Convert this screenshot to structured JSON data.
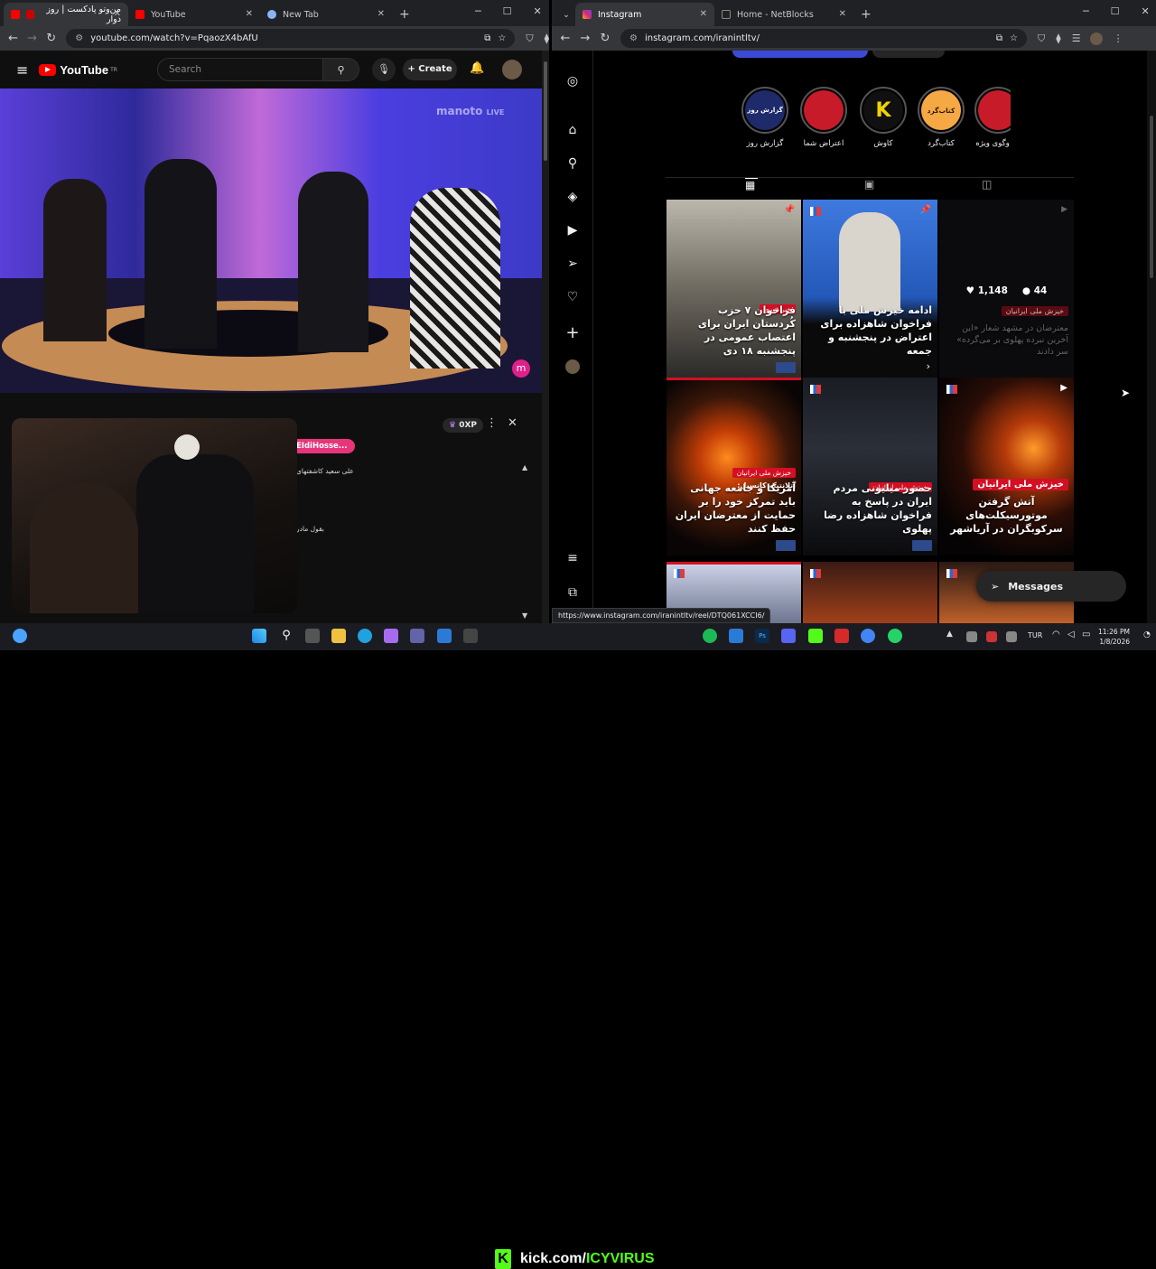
{
  "left_browser": {
    "tabs": [
      {
        "label": "من‌وتو پادکست | روز دوار",
        "active": true
      },
      {
        "label": "YouTube",
        "active": false
      },
      {
        "label": "New Tab",
        "active": false
      }
    ],
    "url": "youtube.com/watch?v=PqaozX4bAfU"
  },
  "youtube": {
    "logo_text": "YouTube",
    "logo_sup": "TR",
    "search_placeholder": "Search",
    "create_label": "Create",
    "video": {
      "watermark": "manoto",
      "live_badge": "LIVE"
    },
    "chat": {
      "points": "0XP",
      "username_chip": "EIdiHosse...",
      "messages": [
        "علی سعید کاشفتهای",
        "بقول مادر"
      ]
    }
  },
  "right_browser": {
    "tabs": [
      {
        "label": "Instagram",
        "active": true
      },
      {
        "label": "Home - NetBlocks",
        "active": false
      }
    ],
    "url": "instagram.com/iranintltv/"
  },
  "instagram": {
    "highlights": [
      {
        "label": "گزارش روز",
        "inner": "گزارش روز"
      },
      {
        "label": "اعتراض شما",
        "inner": ""
      },
      {
        "label": "کاوش",
        "inner": "K"
      },
      {
        "label": "کتاب‌گرد",
        "inner": "کتاب‌گرد"
      },
      {
        "label": "وگوی ویژه",
        "inner": ""
      }
    ],
    "posts": [
      {
        "tag": "خبر فوری",
        "caption": "فراخوان ۷ حزب کُردستان ایران برای اعتصاب عمومی در پنجشنبه ۱۸ دی",
        "pinned": true
      },
      {
        "tag": "",
        "caption": "ادامه خیزش ملی با فراخوان شاهزاده برای اعتراض در پنجشنبه و جمعه",
        "pinned": true
      },
      {
        "tag": "خیزش ملی ایرانیان",
        "caption": "معترضان در مشهد شعار «این آخرین نبرده پهلوی بر می‌گرده» سر دادند",
        "likes": "1,148",
        "comments": "44"
      },
      {
        "tag": "خیزش ملی ایرانیان",
        "subtag": "آتلانتیک کانسیل:",
        "caption": "آمریکا و جامعه جهانی باید تمرکز خود را بر حمایت از معترضان ایران حفظ کنند"
      },
      {
        "tag": "خیزش ملی ایرانیان",
        "caption": "حضور میلیونی مردم ایران در پاسخ به فراخوان شاهزاده رضا پهلوی"
      },
      {
        "tag": "خیزش ملی ایرانیان",
        "caption": "آتش گرفتن موتورسیکلت‌های سرکوبگران در آریاشهر"
      }
    ],
    "messages_label": "Messages",
    "status_url": "https://www.instagram.com/iranintltv/reel/DTQ061XCCI6/"
  },
  "taskbar": {
    "overlay_text_white": "kick.com/",
    "overlay_text_green": "ICYVIRUS",
    "lang": "TUR",
    "time": "11:26 PM",
    "date": "1/8/2026"
  }
}
